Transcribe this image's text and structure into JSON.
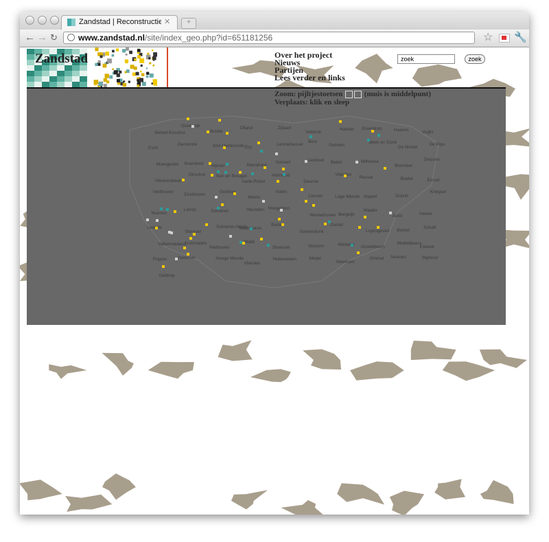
{
  "browser": {
    "tab_title": "Zandstad | Reconstructie van",
    "tab_close": "✕",
    "new_tab": "+",
    "url_host": "www.zandstad.nl",
    "url_path": "/site/index_geo.php?id=651181256"
  },
  "site": {
    "logo_text": "Zandstad",
    "menu": [
      "Over het project",
      "Nieuws",
      "Partijen",
      "Lees verder en links"
    ],
    "search_value": "zoek",
    "search_button": "zoek",
    "zoom_prefix": "Zoom: pijltjestoetsen",
    "zoom_suffix": "(muis is middelpunt)",
    "pan_text": "Verplaats: klik en sleep"
  },
  "map": {
    "places": [
      "Berkel-Enschot",
      "Oisterwijk",
      "Boxtel",
      "Olland",
      "Zijtaart",
      "Veldonk",
      "Handel",
      "Elsendorp",
      "Haaren",
      "Vught",
      "Esch",
      "Gemonde",
      "Sint-Oedenrode",
      "Erp",
      "Lennisheuvel",
      "Best",
      "Gerwen",
      "Beek en Donk",
      "De Mortel",
      "De Rips",
      "Moergestel",
      "Boerdonk",
      "Nijnsel",
      "Mariahout",
      "Gemert",
      "Lieshout",
      "Bakel",
      "Milheeze",
      "Boxmeer",
      "Diessen",
      "Hilvarenbeek",
      "Oirschot",
      "Son en Breugel",
      "Aarle-Rixtel",
      "Helmond",
      "Deurne",
      "Vlierden",
      "Reusel",
      "Bladel",
      "Eersel",
      "Veldhoven",
      "Eindhoven",
      "Geldrop",
      "Mierlo",
      "Asten",
      "Liessel",
      "Lage Mierde",
      "Hapert",
      "Duizel",
      "Knegsel",
      "Nuenen",
      "Lierop",
      "Someren",
      "Heusden",
      "Hoogeloon",
      "Westerhoven",
      "Bergeijk",
      "Waalre",
      "Aalst",
      "Heeze",
      "Leende",
      "Sterksel",
      "Someren-Heide",
      "Maarheeze",
      "Budel",
      "Soerendonk",
      "Gastel",
      "Luyksgestel",
      "Borkel",
      "Schaft",
      "Valkenswaard",
      "Dommelen",
      "Riethoven",
      "Walik",
      "Steensel",
      "Vessem",
      "Wintelre",
      "Oostelbeers",
      "Middelbeers",
      "Esbeek",
      "Poppel",
      "Netersel",
      "Hooge Mierde",
      "Vlierden",
      "Helenaveen",
      "Meijel",
      "Neerkant",
      "Ommel",
      "Nuenen",
      "Stiphout",
      "Geldrop"
    ]
  },
  "colors": {
    "map_background": "#686868",
    "map_point_yellow": "#f0c800",
    "map_point_teal": "#2a9d9d",
    "land_blob": "#a89e8c",
    "logo_red_line": "#d84a2a"
  }
}
